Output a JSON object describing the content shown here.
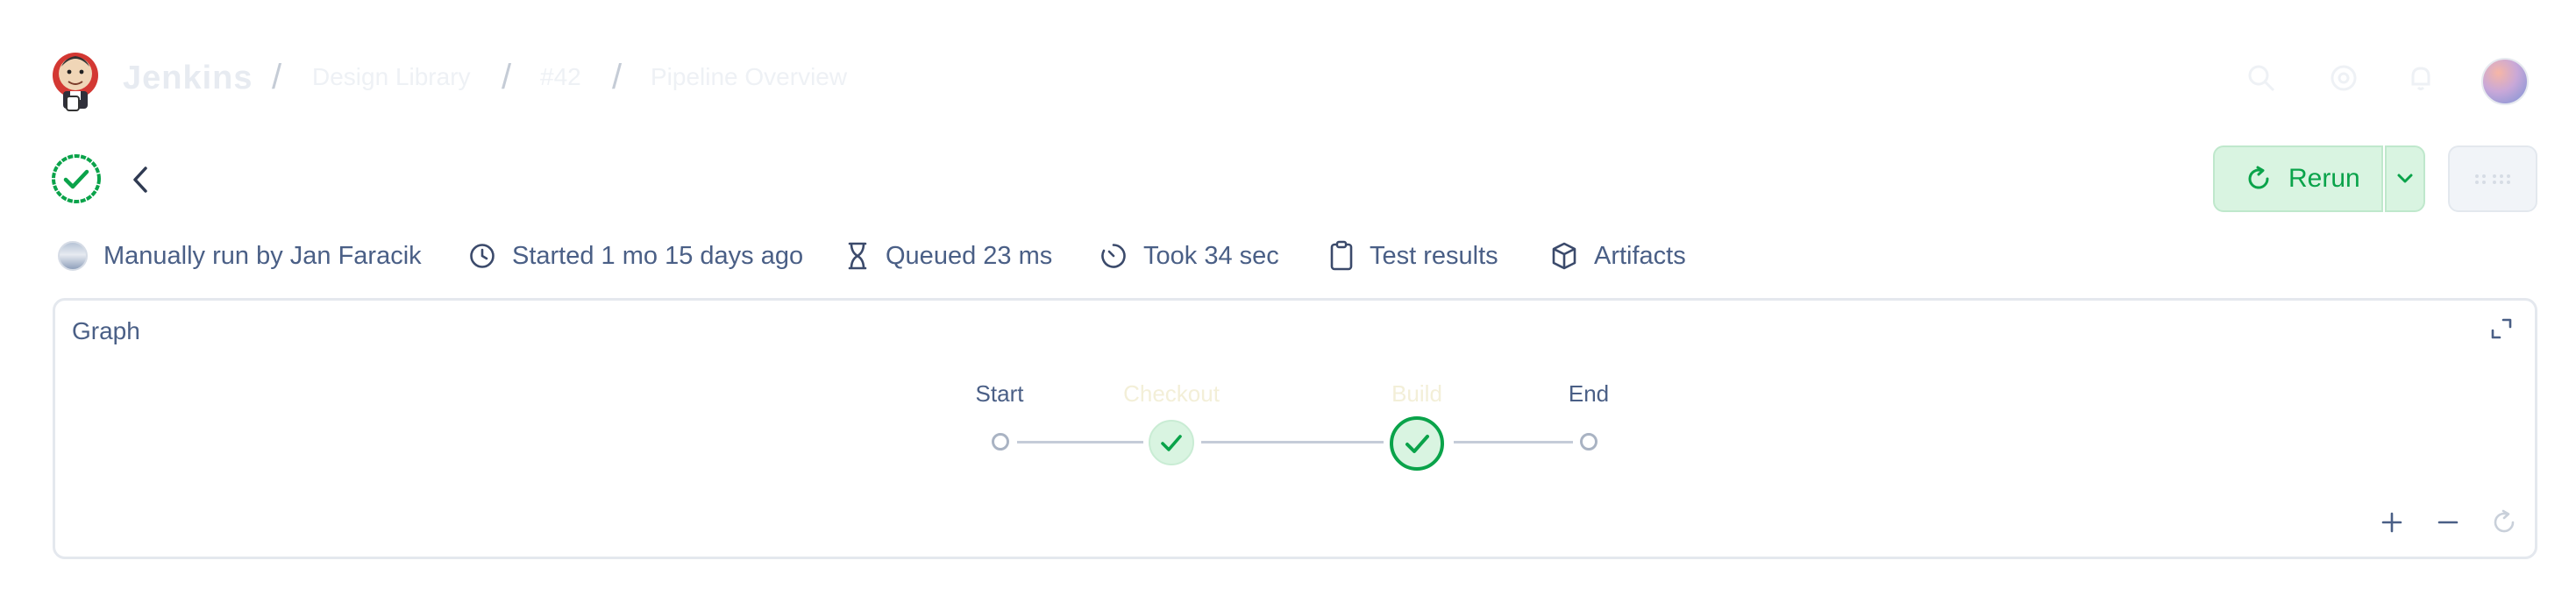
{
  "app": {
    "brand": "Jenkins"
  },
  "breadcrumbs": [
    {
      "label": "Design Library"
    },
    {
      "label": "#42"
    },
    {
      "label": "Pipeline Overview"
    }
  ],
  "header": {
    "status": "success",
    "rerun_label": "Rerun"
  },
  "meta": {
    "run_by": "Manually run by Jan Faracik",
    "started": "Started 1 mo 15 days ago",
    "queued": "Queued 23 ms",
    "took": "Took 34 sec",
    "test_results": "Test results",
    "artifacts": "Artifacts"
  },
  "graph": {
    "title": "Graph",
    "stages": [
      {
        "label": "Start",
        "kind": "terminal"
      },
      {
        "label": "Checkout",
        "kind": "stage",
        "status": "success"
      },
      {
        "label": "Build",
        "kind": "stage",
        "status": "success",
        "selected": true
      },
      {
        "label": "End",
        "kind": "terminal"
      }
    ]
  },
  "colors": {
    "success": "#0aa34a",
    "success_bg": "#d9f4e1",
    "text": "#4a5f86",
    "border": "#e4e8ee"
  },
  "icons": [
    "jenkins-logo",
    "search-icon",
    "settings-icon",
    "notifications-icon",
    "user-avatar",
    "success-icon",
    "chevron-left-icon",
    "refresh-icon",
    "chevron-down-icon",
    "more-icon",
    "clock-icon",
    "hourglass-icon",
    "timer-icon",
    "clipboard-icon",
    "package-icon",
    "expand-icon",
    "zoom-in-icon",
    "zoom-out-icon",
    "reset-zoom-icon"
  ]
}
